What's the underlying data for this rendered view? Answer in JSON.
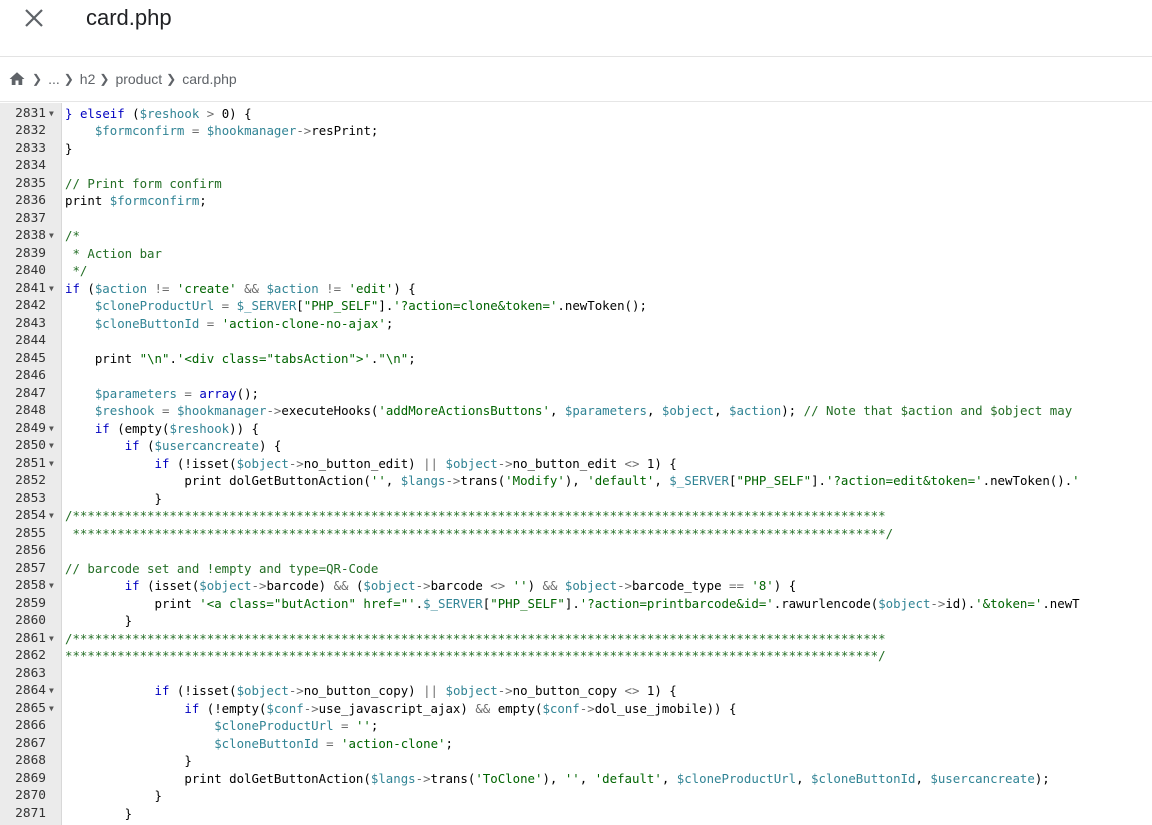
{
  "header": {
    "title": "card.php",
    "close_icon": "close-icon"
  },
  "breadcrumb": {
    "home_icon": "home-icon",
    "items": [
      "...",
      "h2",
      "product",
      "card.php"
    ]
  },
  "editor": {
    "lines": [
      {
        "n": "2831",
        "fold": true,
        "html": "<span class=\"kw\">}</span> <span class=\"kw\">elseif</span> (<span class=\"var\">$reshook</span> <span class=\"op\">&gt;</span> 0) {"
      },
      {
        "n": "2832",
        "fold": false,
        "html": "    <span class=\"var\">$formconfirm</span> <span class=\"op\">=</span> <span class=\"var\">$hookmanager</span><span class=\"op\">-&gt;</span>resPrint;"
      },
      {
        "n": "2833",
        "fold": false,
        "html": "}"
      },
      {
        "n": "2834",
        "fold": false,
        "html": ""
      },
      {
        "n": "2835",
        "fold": false,
        "html": "<span class=\"com\">// Print form confirm</span>"
      },
      {
        "n": "2836",
        "fold": false,
        "html": "print <span class=\"var\">$formconfirm</span>;"
      },
      {
        "n": "2837",
        "fold": false,
        "html": ""
      },
      {
        "n": "2838",
        "fold": true,
        "html": "<span class=\"com\">/*</span>"
      },
      {
        "n": "2839",
        "fold": false,
        "html": "<span class=\"com\"> * Action bar</span>"
      },
      {
        "n": "2840",
        "fold": false,
        "html": "<span class=\"com\"> */</span>"
      },
      {
        "n": "2841",
        "fold": true,
        "html": "<span class=\"kw\">if</span> (<span class=\"var\">$action</span> <span class=\"op\">!=</span> <span class=\"str\">'create'</span> <span class=\"op\">&amp;&amp;</span> <span class=\"var\">$action</span> <span class=\"op\">!=</span> <span class=\"str\">'edit'</span>) {"
      },
      {
        "n": "2842",
        "fold": false,
        "html": "    <span class=\"var\">$cloneProductUrl</span> <span class=\"op\">=</span> <span class=\"var\">$_SERVER</span>[<span class=\"str\">\"PHP_SELF\"</span>].<span class=\"str\">'?action=clone&amp;token='</span>.newToken();"
      },
      {
        "n": "2843",
        "fold": false,
        "html": "    <span class=\"var\">$cloneButtonId</span> <span class=\"op\">=</span> <span class=\"str\">'action-clone-no-ajax'</span>;"
      },
      {
        "n": "2844",
        "fold": false,
        "html": ""
      },
      {
        "n": "2845",
        "fold": false,
        "html": "    print <span class=\"str\">\"\\n\"</span>.<span class=\"str\">'&lt;div class=\"tabsAction\"&gt;'</span>.<span class=\"str\">\"\\n\"</span>;"
      },
      {
        "n": "2846",
        "fold": false,
        "html": ""
      },
      {
        "n": "2847",
        "fold": false,
        "html": "    <span class=\"var\">$parameters</span> <span class=\"op\">=</span> <span class=\"kw\">array</span>();"
      },
      {
        "n": "2848",
        "fold": false,
        "html": "    <span class=\"var\">$reshook</span> <span class=\"op\">=</span> <span class=\"var\">$hookmanager</span><span class=\"op\">-&gt;</span>executeHooks(<span class=\"str\">'addMoreActionsButtons'</span>, <span class=\"var\">$parameters</span>, <span class=\"var\">$object</span>, <span class=\"var\">$action</span>); <span class=\"com\">// Note that $action and $object may</span>"
      },
      {
        "n": "2849",
        "fold": true,
        "html": "    <span class=\"kw\">if</span> (empty(<span class=\"var\">$reshook</span>)) {"
      },
      {
        "n": "2850",
        "fold": true,
        "html": "        <span class=\"kw\">if</span> (<span class=\"var\">$usercancreate</span>) {"
      },
      {
        "n": "2851",
        "fold": true,
        "html": "            <span class=\"kw\">if</span> (!isset(<span class=\"var\">$object</span><span class=\"op\">-&gt;</span>no_button_edit) <span class=\"op\">||</span> <span class=\"var\">$object</span><span class=\"op\">-&gt;</span>no_button_edit <span class=\"op\">&lt;&gt;</span> 1) {"
      },
      {
        "n": "2852",
        "fold": false,
        "html": "                print dolGetButtonAction(<span class=\"str\">''</span>, <span class=\"var\">$langs</span><span class=\"op\">-&gt;</span>trans(<span class=\"str\">'Modify'</span>), <span class=\"str\">'default'</span>, <span class=\"var\">$_SERVER</span>[<span class=\"str\">\"PHP_SELF\"</span>].<span class=\"str\">'?action=edit&amp;token='</span>.newToken().<span class=\"str\">'</span>"
      },
      {
        "n": "2853",
        "fold": false,
        "html": "            }"
      },
      {
        "n": "2854",
        "fold": true,
        "html": "<span class=\"com\">/*************************************************************************************************************</span>"
      },
      {
        "n": "2855",
        "fold": false,
        "html": "<span class=\"com\"> *************************************************************************************************************/</span>"
      },
      {
        "n": "2856",
        "fold": false,
        "html": ""
      },
      {
        "n": "2857",
        "fold": false,
        "html": "<span class=\"com\">// barcode set and !empty and type=QR-Code</span>"
      },
      {
        "n": "2858",
        "fold": true,
        "html": "        <span class=\"kw\">if</span> (isset(<span class=\"var\">$object</span><span class=\"op\">-&gt;</span>barcode) <span class=\"op\">&amp;&amp;</span> (<span class=\"var\">$object</span><span class=\"op\">-&gt;</span>barcode <span class=\"op\">&lt;&gt;</span> <span class=\"str\">''</span>) <span class=\"op\">&amp;&amp;</span> <span class=\"var\">$object</span><span class=\"op\">-&gt;</span>barcode_type <span class=\"op\">==</span> <span class=\"str\">'8'</span>) {"
      },
      {
        "n": "2859",
        "fold": false,
        "html": "            print <span class=\"str\">'&lt;a class=\"butAction\" href=\"'</span>.<span class=\"var\">$_SERVER</span>[<span class=\"str\">\"PHP_SELF\"</span>].<span class=\"str\">'?action=printbarcode&amp;id='</span>.rawurlencode(<span class=\"var\">$object</span><span class=\"op\">-&gt;</span>id).<span class=\"str\">'&amp;token='</span>.newT"
      },
      {
        "n": "2860",
        "fold": false,
        "html": "        }"
      },
      {
        "n": "2861",
        "fold": true,
        "html": "<span class=\"com\">/*************************************************************************************************************</span>"
      },
      {
        "n": "2862",
        "fold": false,
        "html": "<span class=\"com\">*************************************************************************************************************/</span>"
      },
      {
        "n": "2863",
        "fold": false,
        "html": ""
      },
      {
        "n": "2864",
        "fold": true,
        "html": "            <span class=\"kw\">if</span> (!isset(<span class=\"var\">$object</span><span class=\"op\">-&gt;</span>no_button_copy) <span class=\"op\">||</span> <span class=\"var\">$object</span><span class=\"op\">-&gt;</span>no_button_copy <span class=\"op\">&lt;&gt;</span> 1) {"
      },
      {
        "n": "2865",
        "fold": true,
        "html": "                <span class=\"kw\">if</span> (!empty(<span class=\"var\">$conf</span><span class=\"op\">-&gt;</span>use_javascript_ajax) <span class=\"op\">&amp;&amp;</span> empty(<span class=\"var\">$conf</span><span class=\"op\">-&gt;</span>dol_use_jmobile)) {"
      },
      {
        "n": "2866",
        "fold": false,
        "html": "                    <span class=\"var\">$cloneProductUrl</span> <span class=\"op\">=</span> <span class=\"str\">''</span>;"
      },
      {
        "n": "2867",
        "fold": false,
        "html": "                    <span class=\"var\">$cloneButtonId</span> <span class=\"op\">=</span> <span class=\"str\">'action-clone'</span>;"
      },
      {
        "n": "2868",
        "fold": false,
        "html": "                }"
      },
      {
        "n": "2869",
        "fold": false,
        "html": "                print dolGetButtonAction(<span class=\"var\">$langs</span><span class=\"op\">-&gt;</span>trans(<span class=\"str\">'ToClone'</span>), <span class=\"str\">''</span>, <span class=\"str\">'default'</span>, <span class=\"var\">$cloneProductUrl</span>, <span class=\"var\">$cloneButtonId</span>, <span class=\"var\">$usercancreate</span>);"
      },
      {
        "n": "2870",
        "fold": false,
        "html": "            }"
      },
      {
        "n": "2871",
        "fold": false,
        "html": "        }"
      }
    ]
  }
}
